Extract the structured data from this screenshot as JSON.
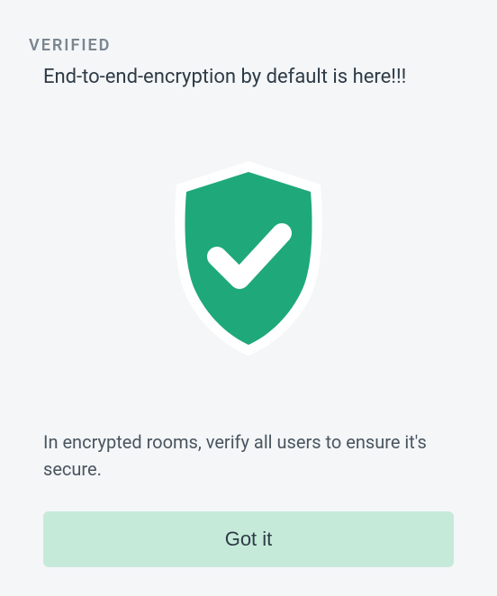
{
  "header": {
    "label": "VERIFIED"
  },
  "title": "End-to-end-encryption by default is here!!!",
  "description": "In encrypted rooms, verify all users to ensure it's secure.",
  "button": {
    "label": "Got it"
  },
  "colors": {
    "shield": "#1fa97a",
    "shieldOutline": "#ffffff",
    "check": "#ffffff"
  }
}
